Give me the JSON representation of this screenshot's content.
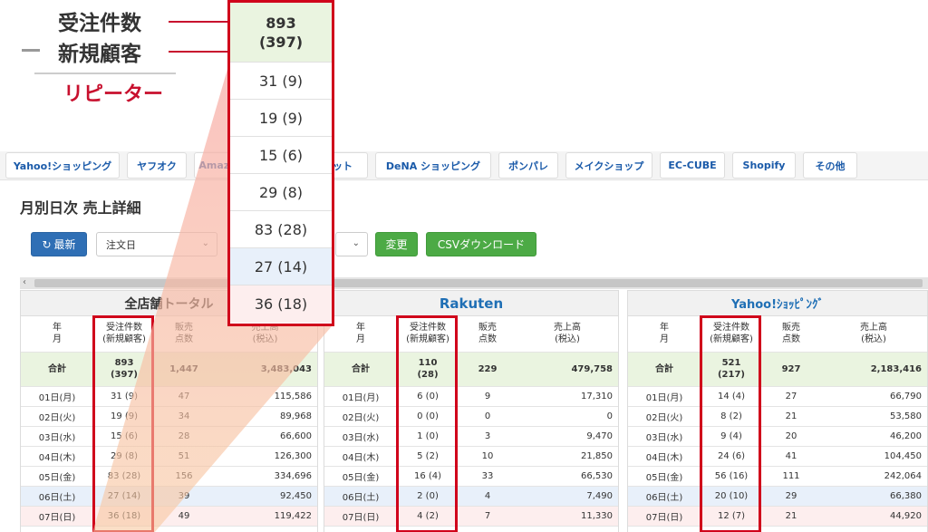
{
  "legend": {
    "line1": "受注件数",
    "line2": "新規顧客",
    "line3": "リピーター"
  },
  "magnifier": {
    "head_total": "893",
    "head_new": "(397)",
    "cells": [
      "31 (9)",
      "19 (9)",
      "15 (6)",
      "29 (8)",
      "83 (28)",
      "27 (14)",
      "36 (18)"
    ]
  },
  "tabs": [
    "Yahoo!ショッピング",
    "ヤフオク",
    "Amazon",
    "",
    "ット",
    "DeNA ショッピング",
    "ポンパレ",
    "メイクショップ",
    "EC-CUBE",
    "Shopify",
    "その他"
  ],
  "page_title": "月別日次 売上詳細",
  "toolbar": {
    "refresh_label": "最新",
    "date_select": "注文日",
    "change_label": "変更",
    "csv_label": "CSVダウンロード"
  },
  "columns": {
    "date": [
      "年",
      "月"
    ],
    "orders": [
      "受注件数",
      "(新規顧客)"
    ],
    "items": [
      "販売",
      "点数"
    ],
    "sales": [
      "売上高",
      "(税込)"
    ]
  },
  "total_label": "合計",
  "days": [
    "01日(月)",
    "02日(火)",
    "03日(水)",
    "04日(木)",
    "05日(金)",
    "06日(土)",
    "07日(日)"
  ],
  "panels": [
    {
      "name": "全店舗トータル",
      "color": "#333333",
      "total": {
        "orders": "893",
        "new": "(397)",
        "items": "1,447",
        "sales": "3,483,043"
      },
      "rows": [
        [
          "31 (9)",
          "47",
          "115,586"
        ],
        [
          "19 (9)",
          "34",
          "89,968"
        ],
        [
          "15 (6)",
          "28",
          "66,600"
        ],
        [
          "29 (8)",
          "51",
          "126,300"
        ],
        [
          "83 (28)",
          "156",
          "334,696"
        ],
        [
          "27 (14)",
          "39",
          "92,450"
        ],
        [
          "36 (18)",
          "49",
          "119,422"
        ]
      ]
    },
    {
      "name": "Rakuten",
      "color": "#1f6fb5",
      "total": {
        "orders": "110",
        "new": "(28)",
        "items": "229",
        "sales": "479,758"
      },
      "rows": [
        [
          "6 (0)",
          "9",
          "17,310"
        ],
        [
          "0 (0)",
          "0",
          "0"
        ],
        [
          "1 (0)",
          "3",
          "9,470"
        ],
        [
          "5 (2)",
          "10",
          "21,850"
        ],
        [
          "16 (4)",
          "33",
          "66,530"
        ],
        [
          "2 (0)",
          "4",
          "7,490"
        ],
        [
          "4 (2)",
          "7",
          "11,330"
        ]
      ]
    },
    {
      "name": "Yahoo!ｼｮｯﾋﾟﾝｸﾞ",
      "color": "#1f6fb5",
      "total": {
        "orders": "521",
        "new": "(217)",
        "items": "927",
        "sales": "2,183,416"
      },
      "rows": [
        [
          "14 (4)",
          "27",
          "66,790"
        ],
        [
          "8 (2)",
          "21",
          "53,580"
        ],
        [
          "9 (4)",
          "20",
          "46,200"
        ],
        [
          "24 (6)",
          "41",
          "104,450"
        ],
        [
          "56 (16)",
          "111",
          "242,064"
        ],
        [
          "20 (10)",
          "29",
          "66,380"
        ],
        [
          "12 (7)",
          "21",
          "44,920"
        ]
      ]
    }
  ],
  "colors": {
    "accent_red": "#d0021b",
    "link_blue": "#1a5aa9",
    "btn_green": "#4caa45",
    "btn_blue": "#2f6fb5"
  }
}
